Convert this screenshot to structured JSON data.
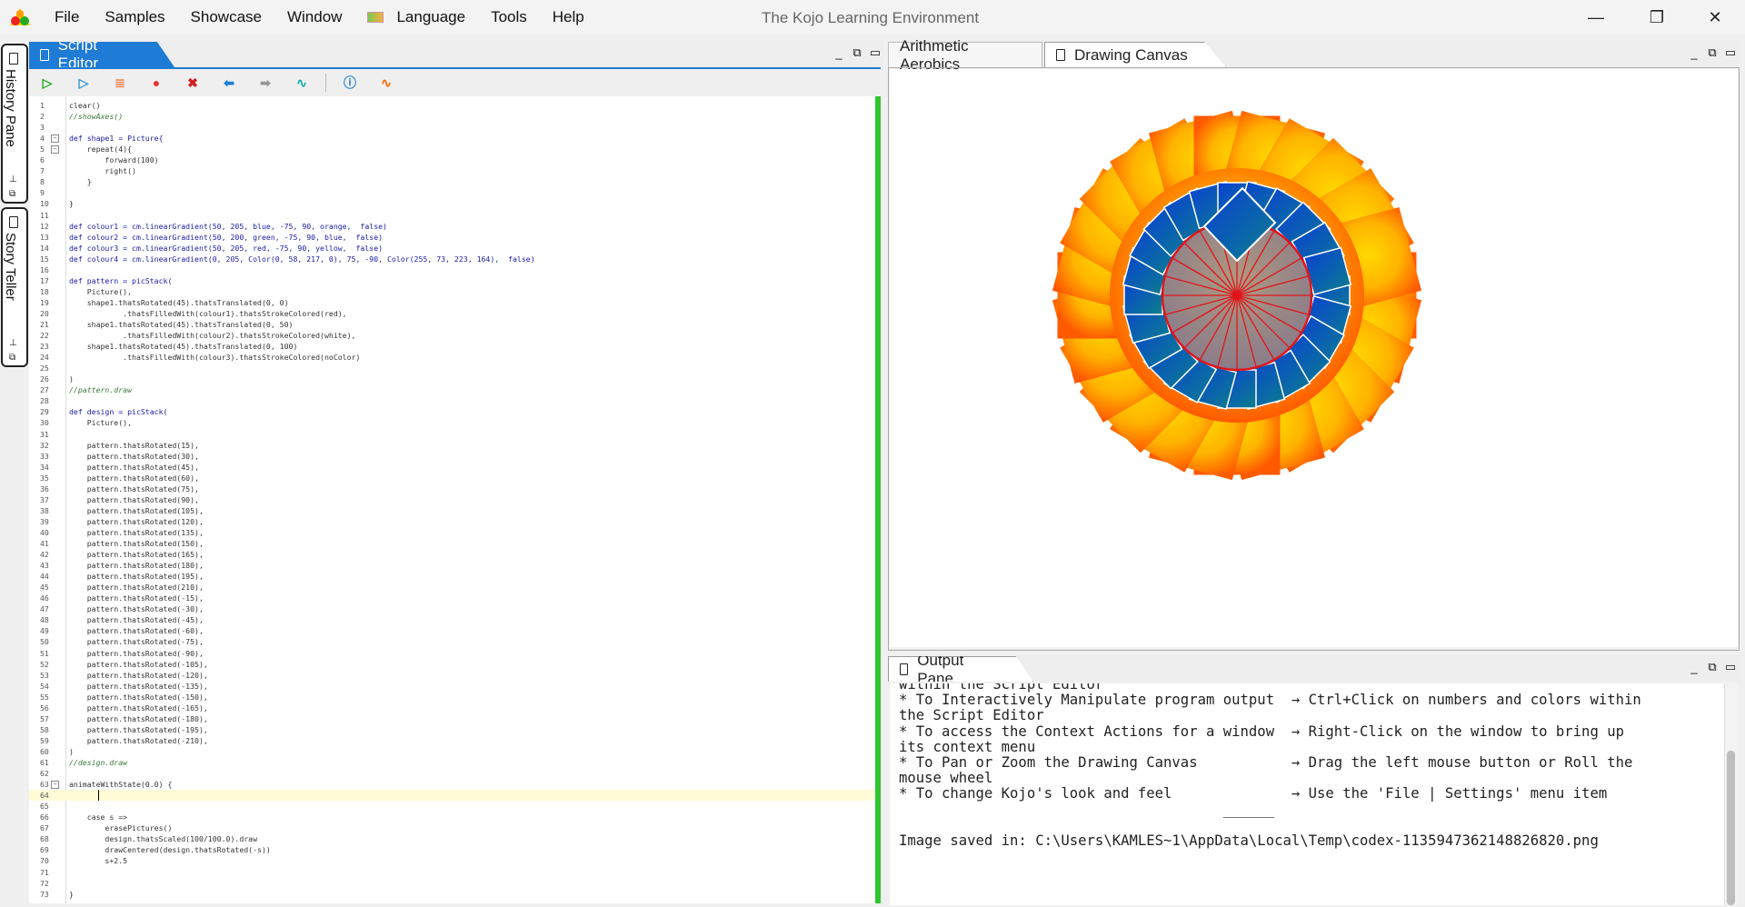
{
  "menubar": {
    "items": [
      "File",
      "Samples",
      "Showcase",
      "Window",
      "Language",
      "Tools",
      "Help"
    ],
    "app_title": "The Kojo Learning Environment",
    "minimize": "—",
    "maximize": "❐",
    "close": "✕"
  },
  "left_dock": {
    "history_label": "History Pane",
    "story_label": "Story Teller"
  },
  "script_editor": {
    "tab_label": "Script Editor",
    "toolbar": [
      "run",
      "run-worksheet",
      "trace",
      "stop",
      "clear-output",
      "undo",
      "redo",
      "format",
      "help",
      "kojo-feedback"
    ],
    "lines": [
      "clear()",
      "//showAxes()",
      "",
      "def shape1 = Picture{",
      "    repeat(4){",
      "        forward(100)",
      "        right()",
      "    }",
      "",
      "}",
      "",
      "def colour1 = cm.linearGradient(50, 205, blue, -75, 90, orange,  false)",
      "def colour2 = cm.linearGradient(50, 200, green, -75, 90, blue,  false)",
      "def colour3 = cm.linearGradient(50, 205, red, -75, 90, yellow,  false)",
      "def colour4 = cm.linearGradient(0, 205, Color(0, 58, 217, 0), 75, -90, Color(255, 73, 223, 164),  false)",
      "",
      "def pattern = picStack(",
      "    Picture(),",
      "    shape1.thatsRotated(45).thatsTranslated(0, 0)",
      "            .thatsFilledWith(colour1).thatsStrokeColored(red),",
      "    shape1.thatsRotated(45).thatsTranslated(0, 50)",
      "            .thatsFilledWith(colour2).thatsStrokeColored(white),",
      "    shape1.thatsRotated(45).thatsTranslated(0, 100)",
      "            .thatsFilledWith(colour3).thatsStrokeColored(noColor)",
      "",
      ")",
      "//pattern.draw",
      "",
      "def design = picStack(",
      "    Picture(),",
      "",
      "    pattern.thatsRotated(15),",
      "    pattern.thatsRotated(30),",
      "    pattern.thatsRotated(45),",
      "    pattern.thatsRotated(60),",
      "    pattern.thatsRotated(75),",
      "    pattern.thatsRotated(90),",
      "    pattern.thatsRotated(105),",
      "    pattern.thatsRotated(120),",
      "    pattern.thatsRotated(135),",
      "    pattern.thatsRotated(150),",
      "    pattern.thatsRotated(165),",
      "    pattern.thatsRotated(180),",
      "    pattern.thatsRotated(195),",
      "    pattern.thatsRotated(210),",
      "    pattern.thatsRotated(-15),",
      "    pattern.thatsRotated(-30),",
      "    pattern.thatsRotated(-45),",
      "    pattern.thatsRotated(-60),",
      "    pattern.thatsRotated(-75),",
      "    pattern.thatsRotated(-90),",
      "    pattern.thatsRotated(-105),",
      "    pattern.thatsRotated(-120),",
      "    pattern.thatsRotated(-135),",
      "    pattern.thatsRotated(-150),",
      "    pattern.thatsRotated(-165),",
      "    pattern.thatsRotated(-180),",
      "    pattern.thatsRotated(-195),",
      "    pattern.thatsRotated(-210),",
      ")",
      "//design.draw",
      "",
      "animateWithState(0.0) {",
      "",
      "",
      "    case s =>",
      "        erasePictures()",
      "        design.thatsScaled(100/100.0).draw",
      "        drawCentered(design.thatsRotated(-s))",
      "        s+2.5",
      "",
      "",
      "}"
    ],
    "fold_lines": [
      4,
      5,
      63
    ],
    "current_line": 64
  },
  "canvas_panel": {
    "tab_arithmetic": "Arithmetic Aerobics",
    "tab_canvas": "Drawing Canvas",
    "colors": {
      "outer_ring": "#ff5a00",
      "inner_yellow": "#ffd800",
      "blue": "#0a3fd6",
      "teal": "#0b7f8c",
      "red_stroke": "#e0151b",
      "center_disc": "#a08a80"
    }
  },
  "output_panel": {
    "tab_label": "Output Pane",
    "lines": [
      "within the Script Editor",
      "* To Interactively Manipulate program output  → Ctrl+Click on numbers and colors within",
      "the Script Editor",
      "* To access the Context Actions for a window  → Right-Click on the window to bring up",
      "its context menu",
      "* To Pan or Zoom the Drawing Canvas           → Drag the left mouse button or Roll the",
      "mouse wheel",
      "* To change Kojo's look and feel              → Use the 'File | Settings' menu item",
      "                                      ______",
      "",
      "Image saved in: C:\\Users\\KAMLES~1\\AppData\\Local\\Temp\\codex-1135947362148826820.png"
    ]
  }
}
